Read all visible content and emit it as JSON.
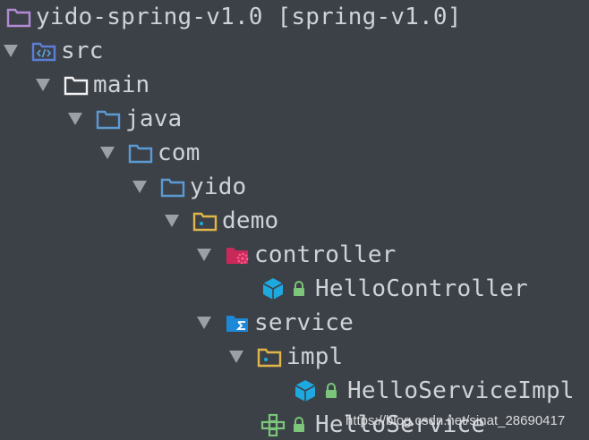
{
  "project": {
    "root_label": "yido-spring-v1.0 [spring-v1.0]"
  },
  "tree": {
    "src": "src",
    "main": "main",
    "java": "java",
    "com": "com",
    "yido": "yido",
    "demo": "demo",
    "controller": "controller",
    "hello_controller": "HelloController",
    "service": "service",
    "impl": "impl",
    "hello_service_impl": "HelloServiceImpl",
    "hello_service": "HelloService"
  },
  "watermark": "https://blog.csdn.net/sinat_28690417",
  "icons": {
    "root": "module-folder-icon",
    "src": "source-root-folder-icon",
    "main": "folder-icon",
    "java": "package-folder-icon",
    "controller": "spring-config-folder-icon",
    "service": "service-folder-icon",
    "class": "class-cube-icon",
    "interface": "interface-icon",
    "lock": "lock-icon",
    "expanded": "chevron-down-icon"
  },
  "colors": {
    "background": "#3c4147",
    "text": "#cfd3d8",
    "blue": "#5b9bd5",
    "yellow": "#e0b64b",
    "pink": "#d6336c",
    "green": "#7bc67b",
    "cyan": "#1ea8e0",
    "purple": "#b48ad6"
  }
}
